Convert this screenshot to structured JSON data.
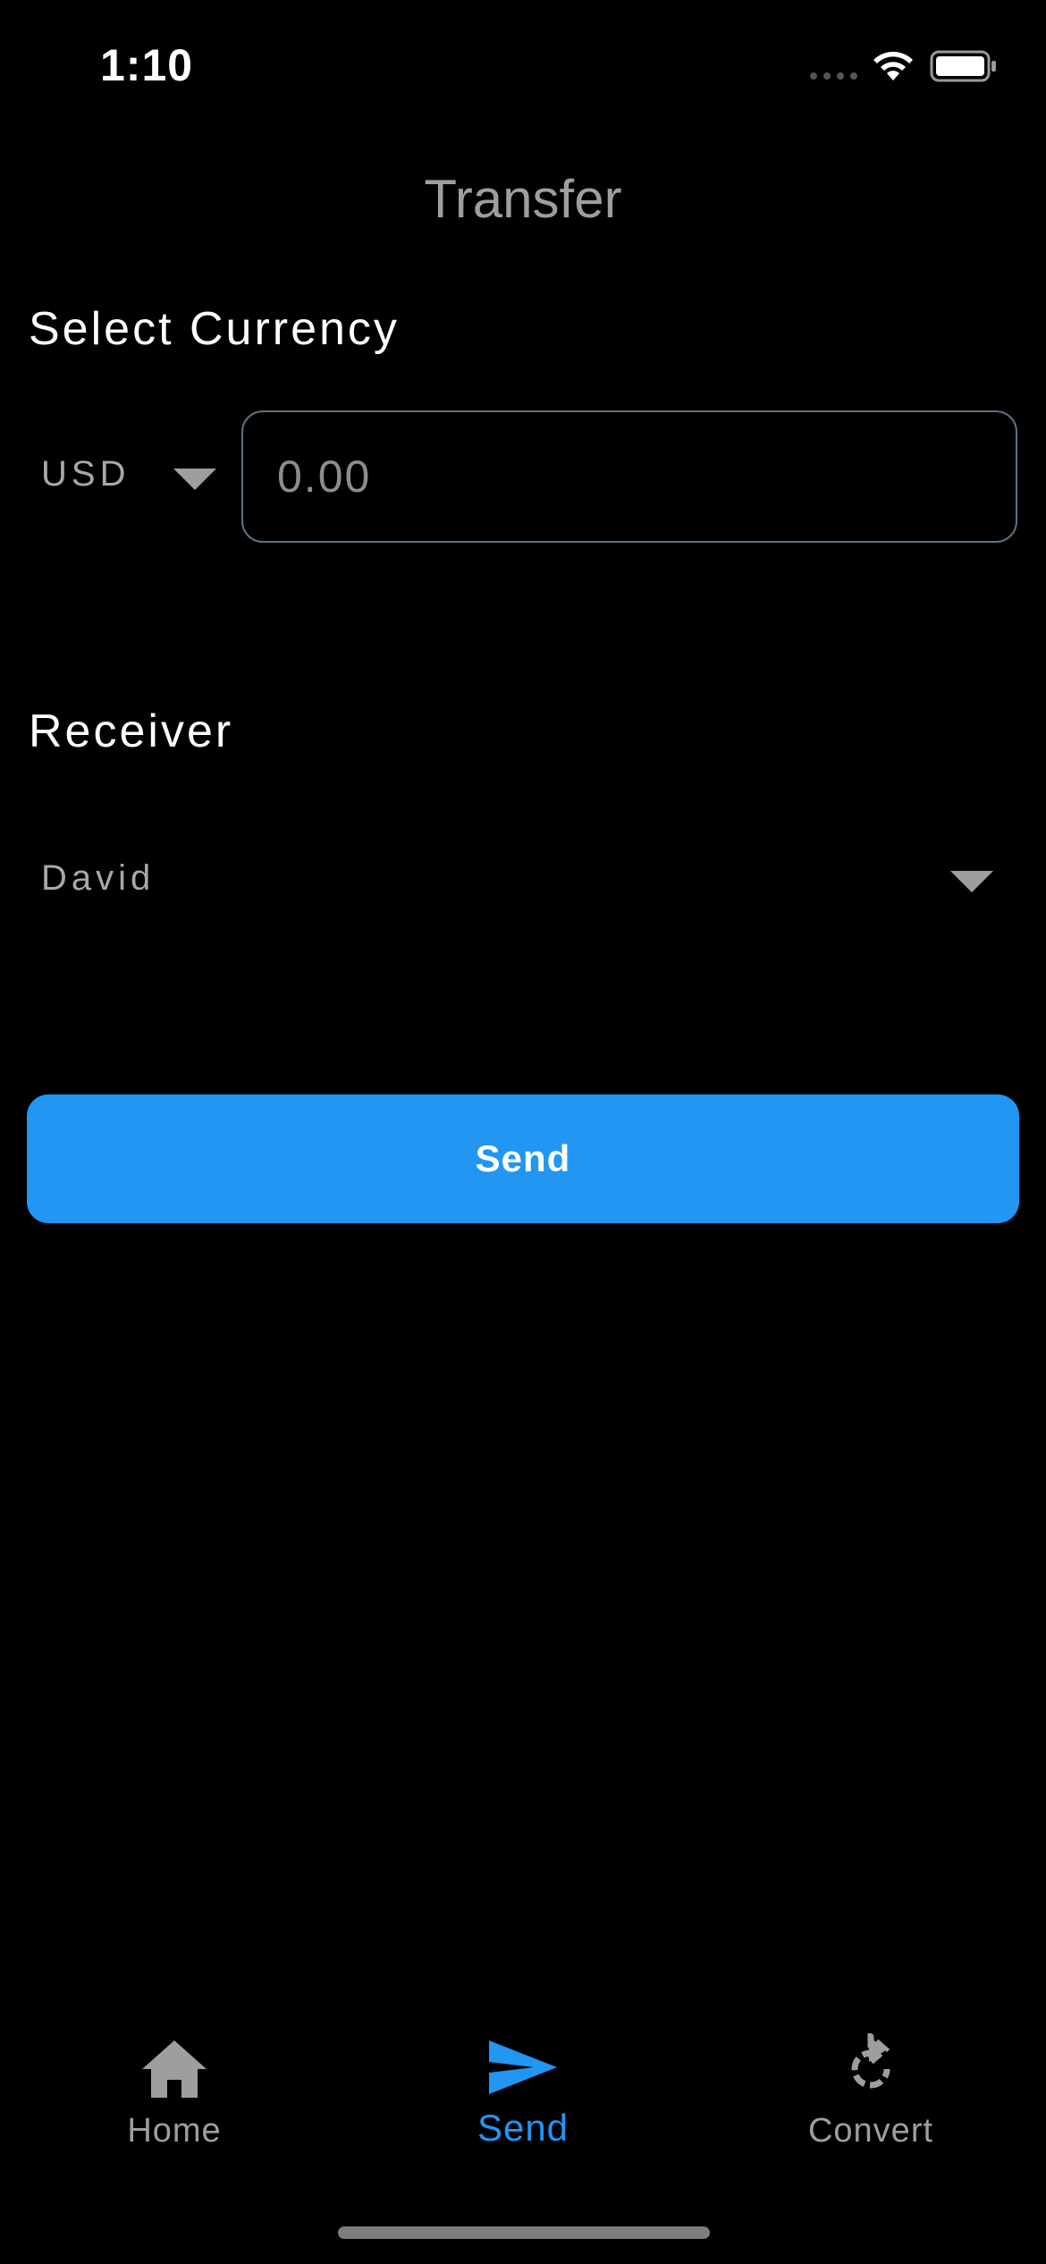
{
  "status_bar": {
    "time": "1:10"
  },
  "header": {
    "title": "Transfer"
  },
  "currency_section": {
    "label": "Select Currency",
    "selected_currency": "USD",
    "amount_placeholder": "0.00",
    "amount_value": ""
  },
  "receiver_section": {
    "label": "Receiver",
    "selected_receiver": "David"
  },
  "actions": {
    "send_label": "Send"
  },
  "tab_bar": {
    "items": [
      {
        "label": "Home",
        "icon": "home-icon",
        "active": false
      },
      {
        "label": "Send",
        "icon": "send-icon",
        "active": true
      },
      {
        "label": "Convert",
        "icon": "refresh-icon",
        "active": false
      }
    ]
  },
  "colors": {
    "background": "#000000",
    "accent": "#2196f3",
    "muted": "#9e9e9e",
    "input_border": "#5f7180"
  }
}
